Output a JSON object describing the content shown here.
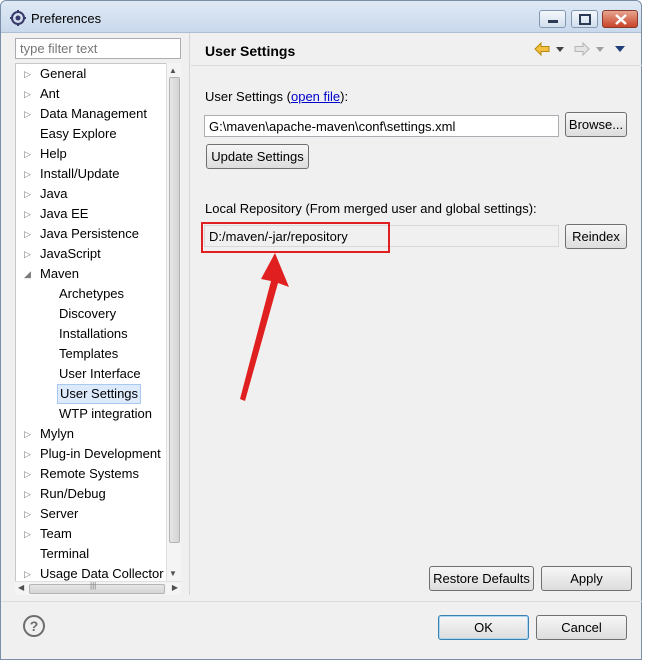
{
  "window": {
    "title": "Preferences"
  },
  "filter": {
    "placeholder": "type filter text"
  },
  "tree": {
    "items": [
      {
        "label": "General",
        "expander": "collapsed",
        "level": 0
      },
      {
        "label": "Ant",
        "expander": "collapsed",
        "level": 0
      },
      {
        "label": "Data Management",
        "expander": "collapsed",
        "level": 0
      },
      {
        "label": "Easy Explore",
        "expander": "none",
        "level": 0
      },
      {
        "label": "Help",
        "expander": "collapsed",
        "level": 0
      },
      {
        "label": "Install/Update",
        "expander": "collapsed",
        "level": 0
      },
      {
        "label": "Java",
        "expander": "collapsed",
        "level": 0
      },
      {
        "label": "Java EE",
        "expander": "collapsed",
        "level": 0
      },
      {
        "label": "Java Persistence",
        "expander": "collapsed",
        "level": 0
      },
      {
        "label": "JavaScript",
        "expander": "collapsed",
        "level": 0
      },
      {
        "label": "Maven",
        "expander": "expanded",
        "level": 0
      },
      {
        "label": "Archetypes",
        "expander": "none",
        "level": 1
      },
      {
        "label": "Discovery",
        "expander": "none",
        "level": 1
      },
      {
        "label": "Installations",
        "expander": "none",
        "level": 1
      },
      {
        "label": "Templates",
        "expander": "none",
        "level": 1
      },
      {
        "label": "User Interface",
        "expander": "none",
        "level": 1
      },
      {
        "label": "User Settings",
        "expander": "none",
        "level": 1,
        "selected": true
      },
      {
        "label": "WTP integration",
        "expander": "none",
        "level": 1
      },
      {
        "label": "Mylyn",
        "expander": "collapsed",
        "level": 0
      },
      {
        "label": "Plug-in Development",
        "expander": "collapsed",
        "level": 0
      },
      {
        "label": "Remote Systems",
        "expander": "collapsed",
        "level": 0
      },
      {
        "label": "Run/Debug",
        "expander": "collapsed",
        "level": 0
      },
      {
        "label": "Server",
        "expander": "collapsed",
        "level": 0
      },
      {
        "label": "Team",
        "expander": "collapsed",
        "level": 0
      },
      {
        "label": "Terminal",
        "expander": "none",
        "level": 0
      },
      {
        "label": "Usage Data Collector",
        "expander": "collapsed",
        "level": 0
      }
    ],
    "hscroll_grip": "|||"
  },
  "page": {
    "title": "User Settings",
    "user_settings_label_prefix": "User Settings (",
    "open_file_link": "open file",
    "user_settings_label_suffix": "):",
    "user_settings_path": "G:\\maven\\apache-maven\\conf\\settings.xml",
    "browse_button": "Browse...",
    "update_settings_button": "Update Settings",
    "local_repo_label": "Local Repository (From merged user and global settings):",
    "local_repo_path": "D:/maven/-jar/repository",
    "reindex_button": "Reindex"
  },
  "footer": {
    "restore_defaults_button": "Restore Defaults",
    "apply_button": "Apply",
    "ok_button": "OK",
    "cancel_button": "Cancel",
    "help_icon": "?"
  },
  "colors": {
    "annotation_red": "#e02020",
    "selection_bg": "#dceafc",
    "link_blue": "#0000cc"
  }
}
